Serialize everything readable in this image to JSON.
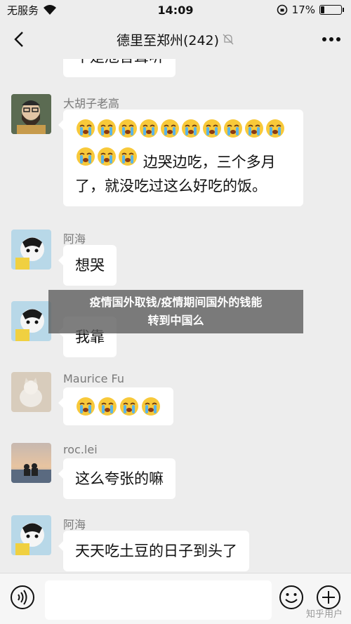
{
  "status": {
    "carrier": "无服务",
    "time": "14:09",
    "battery_percent_label": "17%",
    "battery_level": 0.17
  },
  "nav": {
    "title": "德里至郑州(242)",
    "back_icon": "chevron-left-icon",
    "mute_icon": "bell-off-icon",
    "more_icon": "more-dots-icon"
  },
  "messages": [
    {
      "sender": "",
      "text": "不是危言耸听",
      "emoji_count": 0
    },
    {
      "sender": "大胡子老高",
      "text": "边哭边吃，三个多月了，就没吃过这么好吃的饭。",
      "emoji_count": 13
    },
    {
      "sender": "阿海",
      "text": "想哭",
      "emoji_count": 0
    },
    {
      "sender": "",
      "text": "我靠",
      "emoji_count": 0
    },
    {
      "sender": "Maurice Fu",
      "text": "",
      "emoji_count": 4
    },
    {
      "sender": "roc.lei",
      "text": "这么夸张的嘛",
      "emoji_count": 0
    },
    {
      "sender": "阿海",
      "text": "天天吃土豆的日子到头了",
      "emoji_count": 0
    }
  ],
  "overlay": {
    "line1": "疫情国外取钱/疫情期间国外的钱能",
    "line2": "转到中国么"
  },
  "input_bar": {
    "voice_icon": "voice-icon",
    "emoji_icon": "smiley-icon",
    "plus_icon": "plus-circle-icon",
    "placeholder": ""
  },
  "watermark": "知乎用户"
}
